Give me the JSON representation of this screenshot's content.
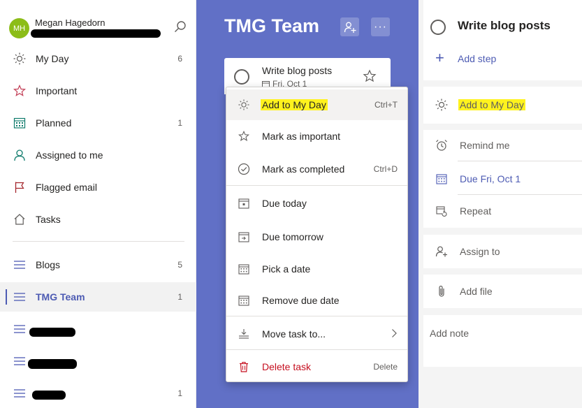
{
  "profile": {
    "initials": "MH",
    "name": "Megan Hagedorn"
  },
  "sidebar": {
    "items": [
      {
        "label": "My Day",
        "count": "6",
        "icon": "sun-icon"
      },
      {
        "label": "Important",
        "count": "",
        "icon": "star-icon"
      },
      {
        "label": "Planned",
        "count": "1",
        "icon": "calendar-icon"
      },
      {
        "label": "Assigned to me",
        "count": "",
        "icon": "person-icon"
      },
      {
        "label": "Flagged email",
        "count": "",
        "icon": "flag-icon"
      },
      {
        "label": "Tasks",
        "count": "",
        "icon": "home-icon"
      }
    ],
    "lists": [
      {
        "label": "Blogs",
        "count": "5"
      },
      {
        "label": "TMG Team",
        "count": "1"
      },
      {
        "label": "",
        "count": ""
      },
      {
        "label": "",
        "count": ""
      },
      {
        "label": "",
        "count": "1"
      }
    ]
  },
  "list": {
    "title": "TMG Team"
  },
  "task": {
    "title": "Write blog posts",
    "due": "Fri, Oct 1"
  },
  "menu": {
    "items": [
      {
        "label": "Add to My Day",
        "shortcut": "Ctrl+T"
      },
      {
        "label": "Mark as important",
        "shortcut": ""
      },
      {
        "label": "Mark as completed",
        "shortcut": "Ctrl+D"
      },
      {
        "label": "Due today",
        "shortcut": ""
      },
      {
        "label": "Due tomorrow",
        "shortcut": ""
      },
      {
        "label": "Pick a date",
        "shortcut": ""
      },
      {
        "label": "Remove due date",
        "shortcut": ""
      },
      {
        "label": "Move task to...",
        "shortcut": ""
      },
      {
        "label": "Delete task",
        "shortcut": "Delete"
      }
    ]
  },
  "detail": {
    "title": "Write blog posts",
    "add_step": "Add step",
    "add_my_day": "Add to My Day",
    "remind_me": "Remind me",
    "due": "Due Fri, Oct 1",
    "repeat": "Repeat",
    "assign_to": "Assign to",
    "add_file": "Add file",
    "add_note": "Add note"
  },
  "colors": {
    "accent": "#4d5bb3",
    "list_bg": "#6170c6",
    "highlight": "#fff21e",
    "danger": "#c50f1f",
    "avatar": "#8cbd18"
  }
}
